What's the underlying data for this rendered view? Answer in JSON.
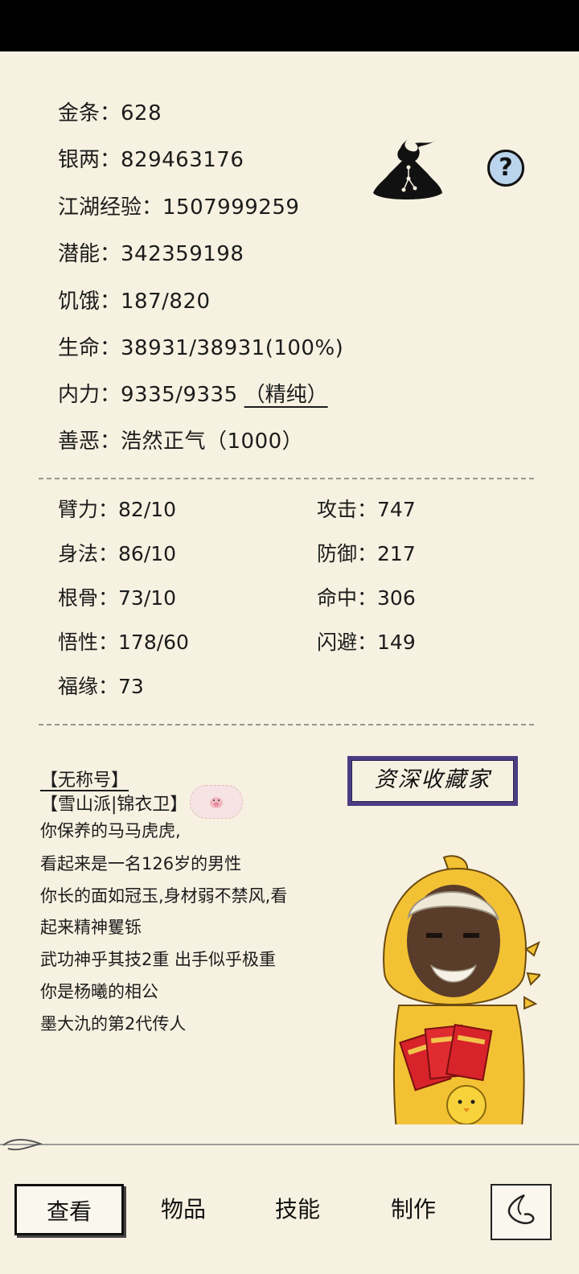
{
  "stats": [
    {
      "label": "金条：",
      "value": "628"
    },
    {
      "label": "银两：",
      "value": "829463176"
    },
    {
      "label": "江湖经验：",
      "value": "1507999259"
    },
    {
      "label": "潜能：",
      "value": "342359198"
    },
    {
      "label": "饥饿：",
      "value": "187/820"
    },
    {
      "label": "生命：",
      "value": "38931/38931(100%)"
    },
    {
      "label": "内力：",
      "value": "9335/9335",
      "tag": "（精纯）"
    },
    {
      "label": "善恶：",
      "value": "浩然正气（1000）"
    }
  ],
  "attributes_left": [
    {
      "label": "臂力：",
      "value": "82/10"
    },
    {
      "label": "身法：",
      "value": "86/10"
    },
    {
      "label": "根骨：",
      "value": "73/10"
    },
    {
      "label": "悟性：",
      "value": "178/60"
    },
    {
      "label": "福缘：",
      "value": "73"
    }
  ],
  "attributes_right": [
    {
      "label": "攻击：",
      "value": "747"
    },
    {
      "label": "防御：",
      "value": "217"
    },
    {
      "label": "命中：",
      "value": "306"
    },
    {
      "label": "闪避：",
      "value": "149"
    }
  ],
  "profile": {
    "title": "【无称号】",
    "sect": "【雪山派|锦衣卫】",
    "description": [
      "你保养的马马虎虎,",
      "看起来是一名126岁的男性",
      "你长的面如冠玉,身材弱不禁风,看",
      "起来精神矍铄",
      "武功神乎其技2重 出手似乎极重",
      "你是杨曦的相公",
      "墨大氿的第2代传人"
    ],
    "badge": "资深收藏家"
  },
  "icons": {
    "meditation": "meditation-figure-icon",
    "help": "question-mark-icon",
    "back": "back-arrow-icon"
  },
  "help_glyph": "?",
  "nav": {
    "tabs": [
      "查看",
      "物品",
      "技能",
      "制作"
    ],
    "active": 0
  },
  "colors": {
    "background": "#f7f1e1",
    "badge_border": "#4b3d82",
    "help_fill": "#b9d4ec",
    "character_yellow": "#f3c234"
  }
}
